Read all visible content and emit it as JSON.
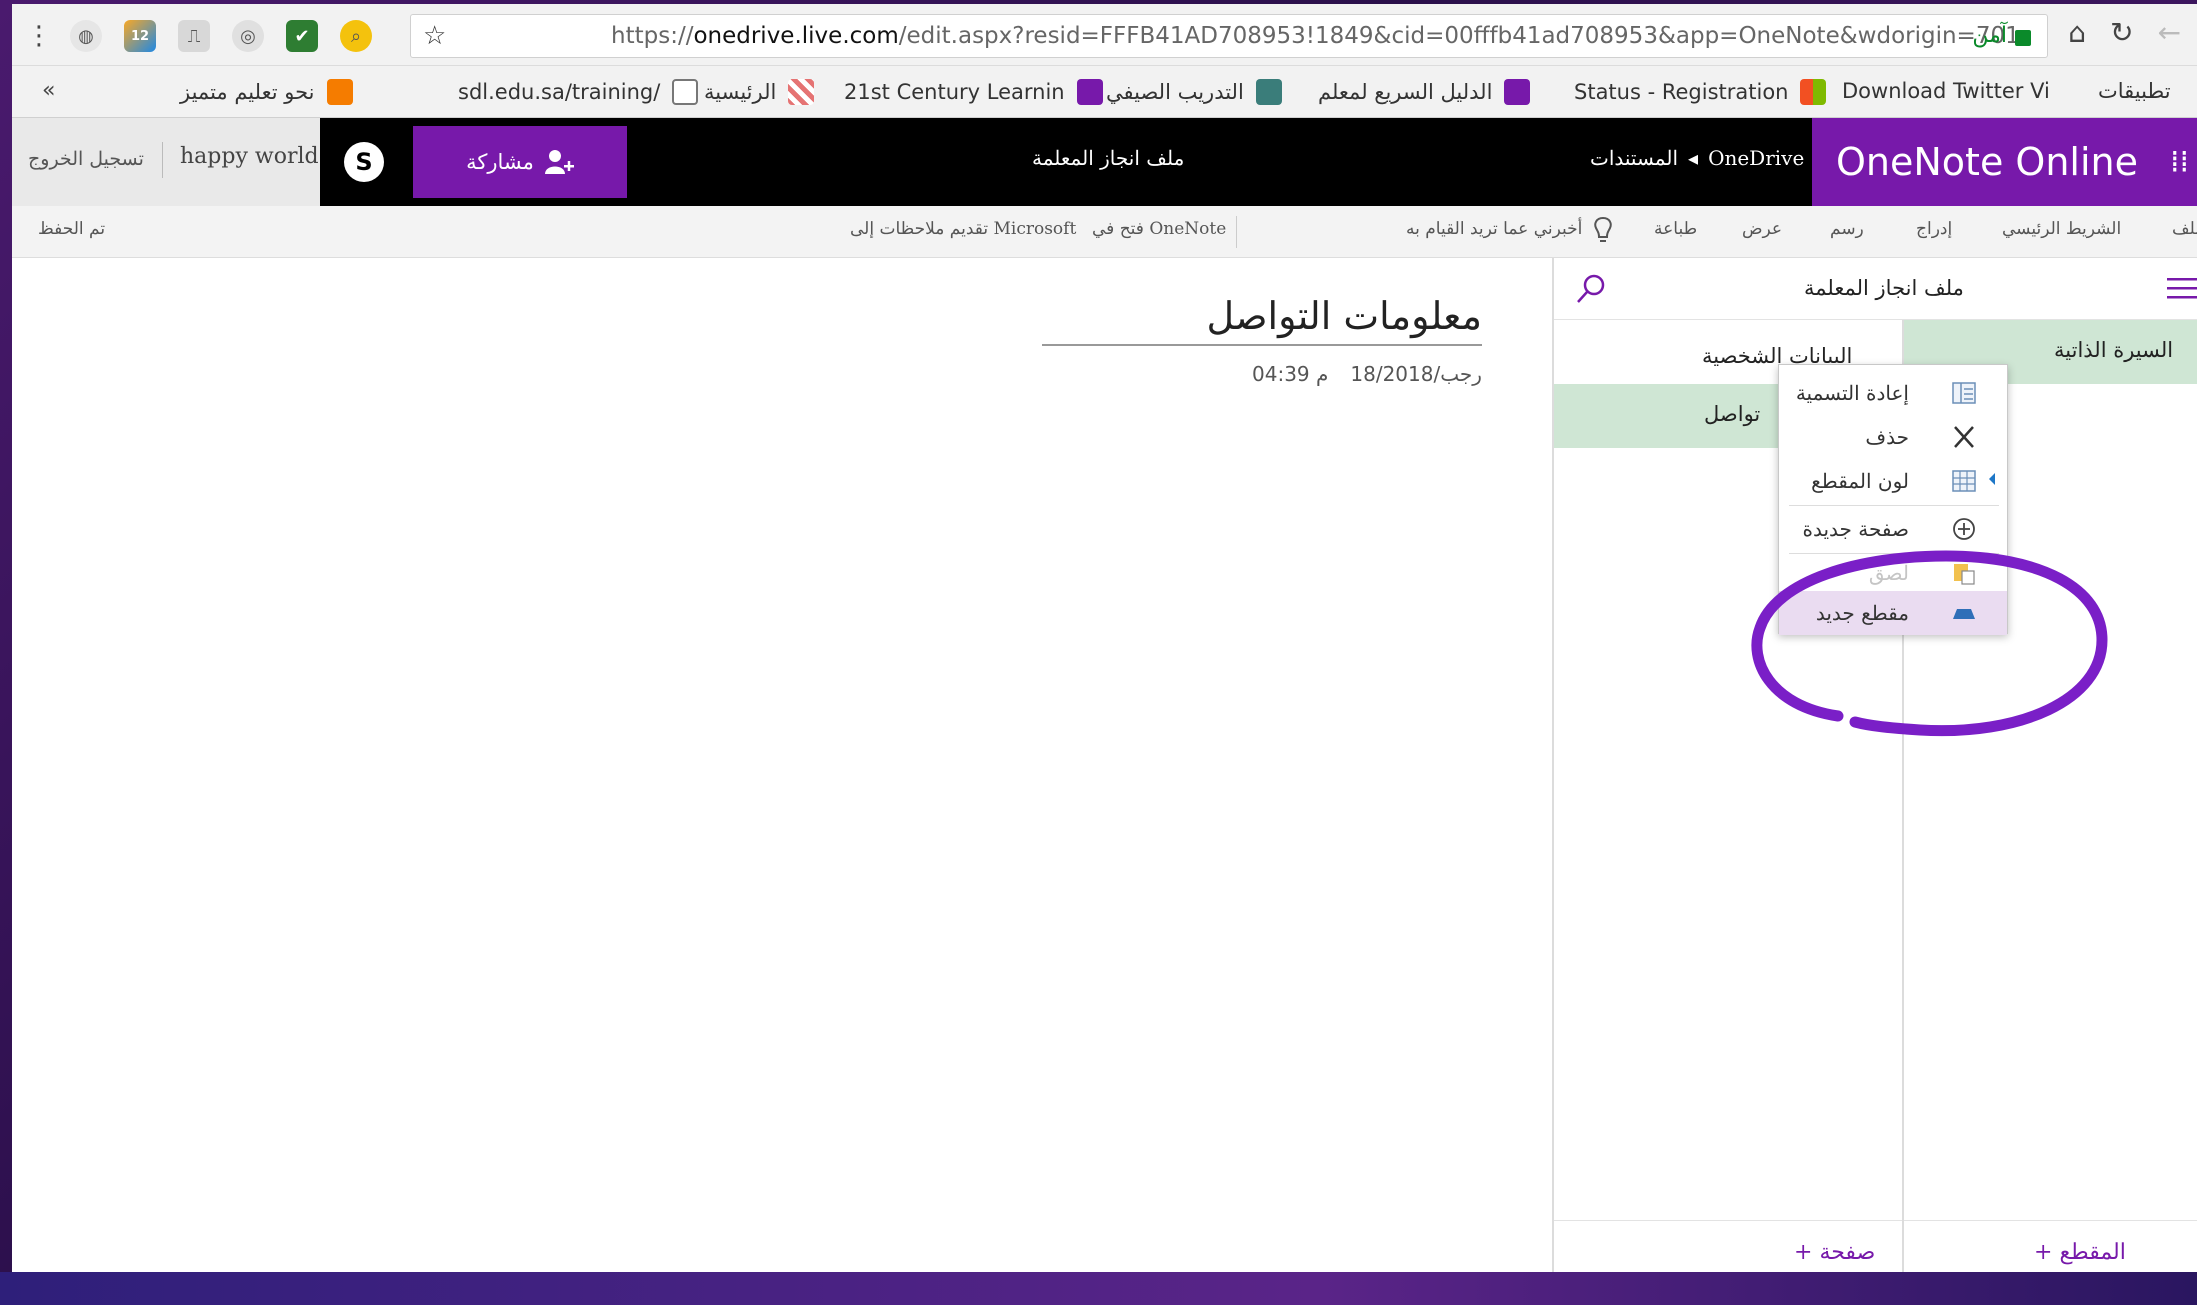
{
  "browser": {
    "url_prefix": "https://",
    "url_host": "onedrive.live.com",
    "url_path": "/edit.aspx?resid=FFFB41AD708953!1849&cid=00fffb41ad708953&app=OneNote&wdorigin=701",
    "secure_label": "آمن",
    "ext_badge": "12",
    "bookmarks": {
      "more": "«",
      "items": [
        "نحو تعليم متميز",
        "sdl.edu.sa/training/",
        "الرئيسية",
        "21st Century Learnin",
        "التدريب الصيفي",
        "الدليل السريع لمعلم",
        "Status - Registration",
        "Download Twitter Vi",
        "تطبيقات"
      ]
    }
  },
  "header": {
    "signout": "تسجيل الخروج",
    "username": "happy world",
    "share": "مشاركة",
    "doc_title": "ملف انجاز المعلمة",
    "breadcrumb_root": "OneDrive",
    "breadcrumb_sep": "◂",
    "breadcrumb_folder": "المستندات",
    "brand": "OneNote Online"
  },
  "ribbon": {
    "saved": "تم الحفظ",
    "present": "تقديم ملاحظات إلى Microsoft",
    "open_in": "فتح في OneNote",
    "tellme": "أخبرني عما تريد القيام به",
    "print": "طباعة",
    "view": "عرض",
    "draw": "رسم",
    "insert": "إدراج",
    "home": "الشريط الرئيسي",
    "file": "ملف"
  },
  "page": {
    "title": "معلومات التواصل",
    "date": "18/رجب/2018",
    "time": "04:39 م"
  },
  "nav": {
    "notebook": "ملف انجاز المعلمة",
    "pages_header": "البيانات الشخصية",
    "sections_header": "السيرة الذاتية",
    "page_item": "تواصل",
    "add_page": "+ صفحة",
    "add_section": "+ المقطع"
  },
  "context_menu": {
    "rename": "إعادة التسمية",
    "delete": "حذف",
    "section_color": "لون المقطع",
    "new_page": "صفحة جديدة",
    "paste": "لصق",
    "new_section": "مقطع جديد"
  },
  "colors": {
    "accent": "#7719aa",
    "section_bg": "#cfe6d4",
    "annotation": "#7a1fc7"
  }
}
